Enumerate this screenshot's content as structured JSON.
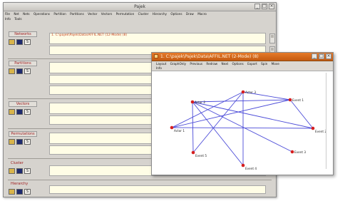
{
  "main_window": {
    "title": "Pajek",
    "menu": [
      "File",
      "Net",
      "Nets",
      "Operations",
      "Partition",
      "Partitions",
      "Vector",
      "Vectors",
      "Permutation",
      "Cluster",
      "Hierarchy",
      "Options",
      "Draw",
      "Macro"
    ],
    "menu_row2": [
      "Info",
      "Tools"
    ],
    "sections": [
      {
        "label": "Networks",
        "value": "1. C:\\pajek\\Pajek\\Data\\AFFIL.NET (12-Mode) (8)"
      },
      {
        "label": "Partitions",
        "value": ""
      },
      {
        "label": "Vectors",
        "value": ""
      },
      {
        "label": "Permutations",
        "value": ""
      },
      {
        "label": "Cluster",
        "value": ""
      },
      {
        "label": "Hierarchy",
        "value": ""
      }
    ],
    "icons": {
      "open": "folder-icon",
      "save": "save-icon",
      "select": "select-icon",
      "select_glyph": "S"
    }
  },
  "draw_window": {
    "title": "1. C:\\pajek\\Pajek\\Data\\AFFIL.NET (2-Mode) (8)",
    "menu": [
      "Layout",
      "GraphOnly",
      "Previous",
      "Redraw",
      "Next",
      "Options",
      "Export",
      "Spin",
      "Move"
    ],
    "menu_row2": [
      "Info"
    ],
    "nodes": [
      {
        "id": "actor3",
        "label": "Actor 3"
      },
      {
        "id": "actor2",
        "label": "Actor 2"
      },
      {
        "id": "event1",
        "label": "Event 1"
      },
      {
        "id": "actor1",
        "label": "Actor 1"
      },
      {
        "id": "event2",
        "label": "Event 2"
      },
      {
        "id": "event5",
        "label": "Event 5"
      },
      {
        "id": "event3",
        "label": "Event 3"
      },
      {
        "id": "event4",
        "label": "Event 4"
      }
    ],
    "edges": [
      [
        "actor3",
        "event1"
      ],
      [
        "actor3",
        "event5"
      ],
      [
        "actor3",
        "actor1"
      ],
      [
        "actor3",
        "event4"
      ],
      [
        "actor2",
        "event1"
      ],
      [
        "actor2",
        "event5"
      ],
      [
        "actor2",
        "event3"
      ],
      [
        "actor2",
        "event4"
      ],
      [
        "actor1",
        "event1"
      ],
      [
        "actor1",
        "event2"
      ],
      [
        "event1",
        "event2"
      ],
      [
        "actor2",
        "event2"
      ]
    ]
  },
  "window_buttons": {
    "minimize": "_",
    "maximize": "□",
    "close": "×"
  }
}
